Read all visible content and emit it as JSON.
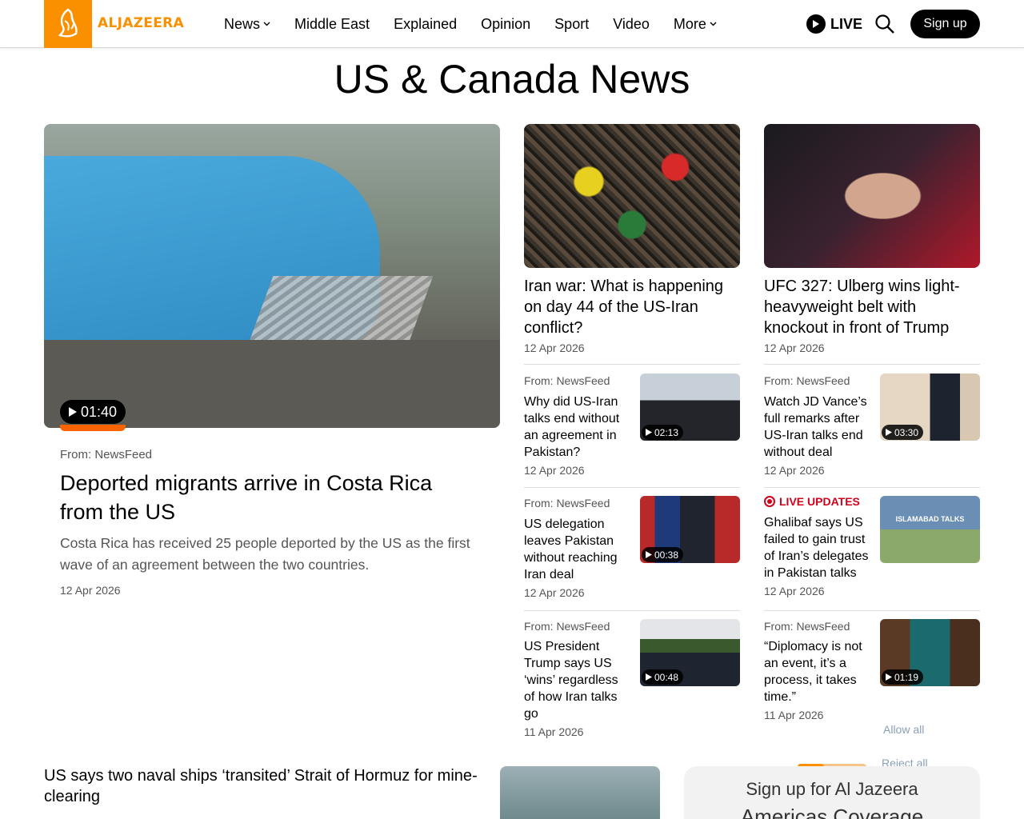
{
  "header": {
    "logo_text": "ALJAZEERA",
    "nav": [
      {
        "label": "News"
      },
      {
        "label": "Middle East"
      },
      {
        "label": "Explained"
      },
      {
        "label": "Opinion"
      },
      {
        "label": "Sport"
      },
      {
        "label": "Video"
      },
      {
        "label": "More"
      }
    ],
    "live_label": "LIVE",
    "signup_label": "Sign up"
  },
  "page": {
    "title": "US & Canada News"
  },
  "lead": {
    "duration": "01:40",
    "progress_fraction": 1.0,
    "source": "From: NewsFeed",
    "title": "Deported migrants arrive in Costa Rica from the US",
    "description": "Costa Rica has received 25 people deported by the US as the first wave of an agreement between the two countries.",
    "date": "12 Apr 2026"
  },
  "features": [
    {
      "title": "Iran war: What is happening on day 44 of the US-Iran conflict?",
      "date": "12 Apr 2026"
    },
    {
      "title": "UFC 327: Ulberg wins light-heavyweight belt with knockout in front of Trump",
      "date": "12 Apr 2026"
    }
  ],
  "cards": [
    {
      "source": "From: NewsFeed",
      "title": "Why did US-Iran talks end without an agreement in Pakistan?",
      "date": "12 Apr 2026",
      "duration": "02:13"
    },
    {
      "source": "From: NewsFeed",
      "title": "Watch JD Vance’s full remarks after US-Iran talks end without deal",
      "date": "12 Apr 2026",
      "duration": "03:30"
    },
    {
      "source": "From: NewsFeed",
      "title": "US delegation leaves Pakistan without reaching Iran deal",
      "date": "12 Apr 2026",
      "duration": "00:38"
    },
    {
      "source": "LIVE UPDATES",
      "title": "Ghalibaf says US failed to gain trust of Iran’s delegates in Pakistan talks",
      "date": "12 Apr 2026",
      "thumb_text": "ISLAMABAD TALKS"
    },
    {
      "source": "From: NewsFeed",
      "title": "US President Trump says US ‘wins’ regardless of how Iran talks go",
      "date": "11 Apr 2026",
      "duration": "00:48"
    },
    {
      "source": "From: NewsFeed",
      "title": "“Diplomacy is not an event, it’s a process, it takes time.”",
      "date": "11 Apr 2026",
      "duration": "01:19"
    }
  ],
  "bottom": {
    "headline": "US says two naval ships ‘transited’ Strait of Hormuz for mine-clearing",
    "signup_line1": "Sign up for Al Jazeera",
    "signup_line2": "Americas Coverage"
  },
  "cookie": {
    "allow_label": "Allow all",
    "reject_label": "Reject all",
    "progress_fraction": 0.38
  },
  "colors": {
    "brand": "#fa9000",
    "live": "#d0021b"
  }
}
